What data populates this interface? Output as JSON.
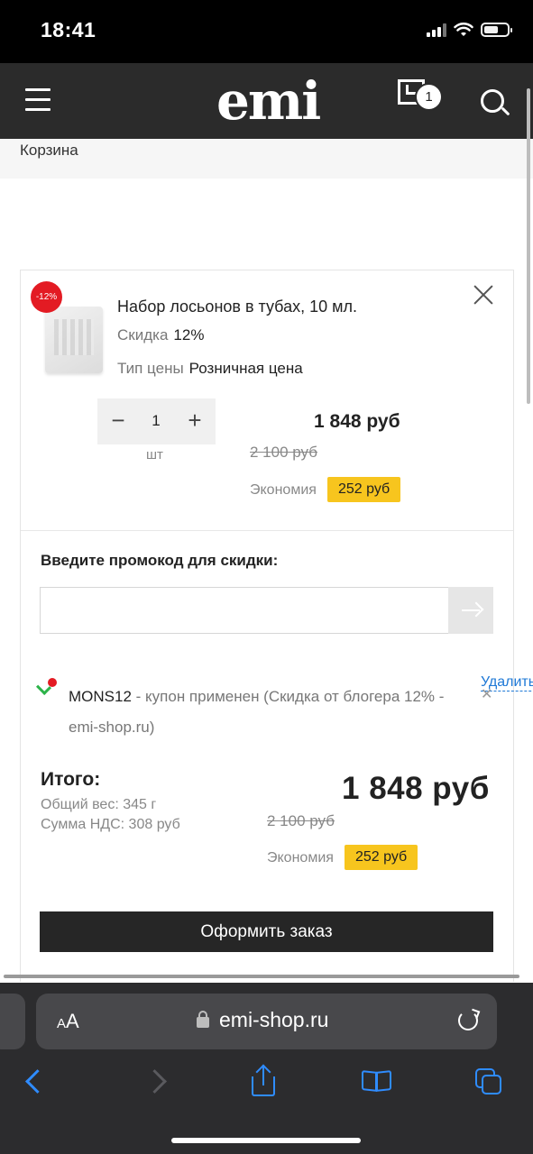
{
  "status_bar": {
    "time": "18:41"
  },
  "header": {
    "logo": "emi",
    "cart_count": "1"
  },
  "breadcrumb": "Корзина",
  "cart_item": {
    "discount_badge": "-12%",
    "title": "Набор лосьонов в тубах, 10 мл.",
    "discount_label": "Скидка",
    "discount_value": "12%",
    "price_type_label": "Тип цены",
    "price_type_value": "Розничная цена",
    "quantity": "1",
    "unit": "шт",
    "minus": "−",
    "plus": "+",
    "price": "1 848 руб",
    "old_price": "2 100 руб",
    "savings_label": "Экономия",
    "savings_value": "252 руб"
  },
  "promo": {
    "label": "Введите промокод для скидки:",
    "input_value": "",
    "coupon_code": "MONS12",
    "coupon_text": " - купон применен (Скидка от блогера 12% - emi-shop.ru)",
    "remove_label": "Удалить",
    "remove_x": "✕"
  },
  "totals": {
    "label": "Итого:",
    "weight": "Общий вес: 345 г",
    "vat": "Сумма НДС: 308 руб",
    "price": "1 848 руб",
    "old_price": "2 100 руб",
    "savings_label": "Экономия",
    "savings_value": "252 руб"
  },
  "order_button": "Оформить заказ",
  "browser": {
    "aa_small": "A",
    "aa_large": "A",
    "url": "emi-shop.ru"
  },
  "colors": {
    "header_bg": "#2b2b2b",
    "badge_red": "#e31b23",
    "savings_yellow": "#f7c51e",
    "link_blue": "#1e78d6",
    "safari_blue": "#2f8cff"
  }
}
